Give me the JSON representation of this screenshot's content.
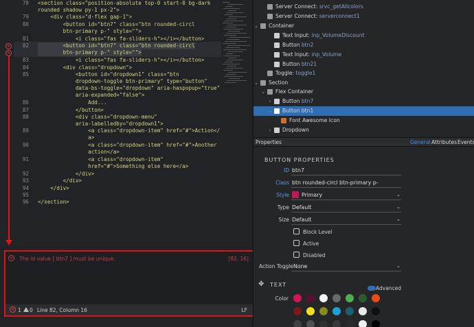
{
  "editor": {
    "lines": [
      {
        "num": "78",
        "text": "<section class=\"position-absolute top-0 start-0 bg-dark"
      },
      {
        "num": "",
        "text": "rounded shadow py-1 px-2\">"
      },
      {
        "num": "79",
        "text": "    <div class=\"d-flex gap-1\">"
      },
      {
        "num": "80",
        "text": "        <button id=\"btn7\" class=\"btn rounded-circl"
      },
      {
        "num": "",
        "text": "        btn-primary p-\" style=\"\">"
      },
      {
        "num": "81",
        "text": "            <i class=\"fas fa-sliders-h\"></i></button>"
      },
      {
        "num": "82",
        "text": "        <button id=\"btn7\" class=\"btn rounded-circl"
      },
      {
        "num": "",
        "text": "        btn-primary p-\" style=\"\">"
      },
      {
        "num": "83",
        "text": "            <i class=\"fas fa-sliders-h\"></i></button>"
      },
      {
        "num": "84",
        "text": "        <div class=\"dropdown\">"
      },
      {
        "num": "85",
        "text": "            <button id=\"dropdown1\" class=\"btn"
      },
      {
        "num": "",
        "text": "            dropdown-toggle btn-primary\" type=\"button\""
      },
      {
        "num": "",
        "text": "            data-bs-toggle=\"dropdown\" aria-haspopup=\"true\""
      },
      {
        "num": "",
        "text": "            aria-expanded=\"false\">"
      },
      {
        "num": "86",
        "text": "                Add..."
      },
      {
        "num": "87",
        "text": "            </button>"
      },
      {
        "num": "88",
        "text": "            <div class=\"dropdown-menu\""
      },
      {
        "num": "",
        "text": "            aria-labelledby=\"dropdown1\">"
      },
      {
        "num": "89",
        "text": "                <a class=\"dropdown-item\" href=\"#\">Action</"
      },
      {
        "num": "",
        "text": "                a>"
      },
      {
        "num": "90",
        "text": "                <a class=\"dropdown-item\" href=\"#\">Another"
      },
      {
        "num": "",
        "text": "                action</a>"
      },
      {
        "num": "91",
        "text": "                <a class=\"dropdown-item\""
      },
      {
        "num": "",
        "text": "                href=\"#\">Something else here</a>"
      },
      {
        "num": "92",
        "text": "            </div>"
      },
      {
        "num": "93",
        "text": "        </div>"
      },
      {
        "num": "94",
        "text": "    </div>"
      },
      {
        "num": "95",
        "text": ""
      },
      {
        "num": "96",
        "text": "</section>"
      }
    ]
  },
  "errors": {
    "message": "The id value [ btn7 ] must be unique.",
    "position": "[82, 16]"
  },
  "status_bar": {
    "error_count": "1",
    "warning_count": "0",
    "cursor": "Line 82, Column 16",
    "line_ending": "LF"
  },
  "tree": {
    "items": [
      {
        "label": "Server Connect:",
        "sub": "srvc_getAllcolors"
      },
      {
        "label": "Server Connect:",
        "sub": "serverconnect1"
      },
      {
        "label": "Container",
        "sub": ""
      },
      {
        "label": "Text Input:",
        "sub": "inp_VolumeDiscount"
      },
      {
        "label": "Button",
        "sub": "btn2"
      },
      {
        "label": "Text Input:",
        "sub": "inp_Volume"
      },
      {
        "label": "Button",
        "sub": "btn21"
      },
      {
        "label": "Toggle:",
        "sub": "toggle1"
      },
      {
        "label": "Section",
        "sub": ""
      },
      {
        "label": "Flex Container",
        "sub": ""
      },
      {
        "label": "Button",
        "sub": "btn7"
      },
      {
        "label": "Button btn1",
        "sub": ""
      },
      {
        "label": "Font Awesome Icon",
        "sub": ""
      },
      {
        "label": "Dropdown",
        "sub": ""
      }
    ]
  },
  "properties": {
    "title": "Properties",
    "tabs": [
      "General",
      "Attributes",
      "Events"
    ],
    "section": "BUTTON PROPERTIES",
    "id_label": "ID",
    "id_value": "btn7",
    "class_label": "Class",
    "class_value": "btn rounded-circl btn-primary p-",
    "style_label": "Style",
    "style_value": "Primary",
    "style_color": "#c2185b",
    "type_label": "Type",
    "type_value": "Default",
    "size_label": "Size",
    "size_value": "Default",
    "checkboxes": [
      "Block Level",
      "Active",
      "Disabled"
    ],
    "action_toggle_label": "Action Toggle",
    "action_toggle_value": "None",
    "text_section": "TEXT",
    "advanced_label": "Advanced",
    "color_label": "Color",
    "colors": [
      "#d4145a",
      "#5a1030",
      "#f4f4f4",
      "#6a6a6a",
      "#4caf50",
      "#2e5a2e",
      "#e84a1a",
      "#7a1a1a",
      "#f0e020",
      "#8a8a20",
      "#20a0d0",
      "#1a6070",
      "#e8e8e8",
      "#101010",
      "#404040",
      "#505050",
      "#303030",
      "#383838",
      "#2a2a2a",
      "#f0f0f0",
      "#000000"
    ]
  }
}
